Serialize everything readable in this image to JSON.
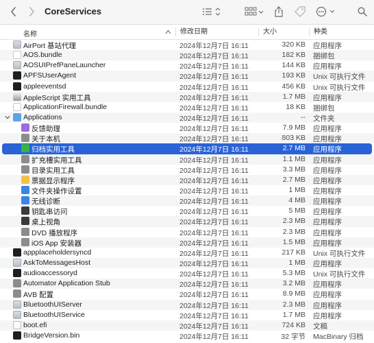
{
  "window": {
    "title": "CoreServices"
  },
  "columns": {
    "name": "名称",
    "date": "修改日期",
    "size": "大小",
    "kind": "种类"
  },
  "rows": [
    {
      "name": "AirPort 基站代理",
      "date": "2024年12月7日 16:11",
      "size": "320 KB",
      "kind": "应用程序",
      "icon": "app-icon",
      "indent": 0
    },
    {
      "name": "AOS.bundle",
      "date": "2024年12月7日 16:11",
      "size": "182 KB",
      "kind": "捆绑包",
      "icon": "bundle-icon",
      "indent": 0
    },
    {
      "name": "AOSUIPrefPaneLauncher",
      "date": "2024年12月7日 16:11",
      "size": "144 KB",
      "kind": "应用程序",
      "icon": "app-icon",
      "indent": 0
    },
    {
      "name": "APFSUserAgent",
      "date": "2024年12月7日 16:11",
      "size": "193 KB",
      "kind": "Unix 可执行文件",
      "icon": "exec-icon",
      "indent": 0
    },
    {
      "name": "appleeventsd",
      "date": "2024年12月7日 16:11",
      "size": "456 KB",
      "kind": "Unix 可执行文件",
      "icon": "exec-icon",
      "indent": 0
    },
    {
      "name": "AppleScript 实用工具",
      "date": "2024年12月7日 16:11",
      "size": "1.7 MB",
      "kind": "应用程序",
      "icon": "script-icon",
      "indent": 0
    },
    {
      "name": "ApplicationFirewall.bundle",
      "date": "2024年12月7日 16:11",
      "size": "18 KB",
      "kind": "捆绑包",
      "icon": "bundle-icon",
      "indent": 0
    },
    {
      "name": "Applications",
      "date": "2024年12月7日 16:11",
      "size": "--",
      "kind": "文件夹",
      "icon": "folder-icon",
      "indent": 0,
      "expanded": true
    },
    {
      "name": "反馈助理",
      "date": "2024年12月7日 16:11",
      "size": "7.9 MB",
      "kind": "应用程序",
      "icon": "purple-app-icon",
      "indent": 1
    },
    {
      "name": "关于本机",
      "date": "2024年12月7日 16:11",
      "size": "803 KB",
      "kind": "应用程序",
      "icon": "gray-app-icon",
      "indent": 1
    },
    {
      "name": "归档实用工具",
      "date": "2024年12月7日 16:11",
      "size": "2.7 MB",
      "kind": "应用程序",
      "icon": "green-app-icon",
      "indent": 1,
      "selected": true
    },
    {
      "name": "扩充槽实用工具",
      "date": "2024年12月7日 16:11",
      "size": "1.1 MB",
      "kind": "应用程序",
      "icon": "gray-app-icon",
      "indent": 1
    },
    {
      "name": "目录实用工具",
      "date": "2024年12月7日 16:11",
      "size": "3.3 MB",
      "kind": "应用程序",
      "icon": "gray-app-icon",
      "indent": 1
    },
    {
      "name": "票据显示程序",
      "date": "2024年12月7日 16:11",
      "size": "2.7 MB",
      "kind": "应用程序",
      "icon": "yellow-app-icon",
      "indent": 1
    },
    {
      "name": "文件夹操作设置",
      "date": "2024年12月7日 16:11",
      "size": "1 MB",
      "kind": "应用程序",
      "icon": "blue-app-icon",
      "indent": 1
    },
    {
      "name": "无线诊断",
      "date": "2024年12月7日 16:11",
      "size": "4 MB",
      "kind": "应用程序",
      "icon": "blue-app-icon",
      "indent": 1
    },
    {
      "name": "钥匙串访问",
      "date": "2024年12月7日 16:11",
      "size": "5 MB",
      "kind": "应用程序",
      "icon": "dark-app-icon",
      "indent": 1
    },
    {
      "name": "桌上视角",
      "date": "2024年12月7日 16:11",
      "size": "2.3 MB",
      "kind": "应用程序",
      "icon": "dark-app-icon",
      "indent": 1
    },
    {
      "name": "DVD 播放程序",
      "date": "2024年12月7日 16:11",
      "size": "2.3 MB",
      "kind": "应用程序",
      "icon": "gray-app-icon",
      "indent": 1
    },
    {
      "name": "iOS App 安装器",
      "date": "2024年12月7日 16:11",
      "size": "1.5 MB",
      "kind": "应用程序",
      "icon": "gray-app-icon",
      "indent": 1
    },
    {
      "name": "appplaceholdersyncd",
      "date": "2024年12月7日 16:11",
      "size": "217 KB",
      "kind": "Unix 可执行文件",
      "icon": "exec-icon",
      "indent": 0
    },
    {
      "name": "AskToMessagesHost",
      "date": "2024年12月7日 16:11",
      "size": "1 MB",
      "kind": "应用程序",
      "icon": "app-icon",
      "indent": 0
    },
    {
      "name": "audioaccessoryd",
      "date": "2024年12月7日 16:11",
      "size": "5.3 MB",
      "kind": "Unix 可执行文件",
      "icon": "exec-icon",
      "indent": 0
    },
    {
      "name": "Automator Application Stub",
      "date": "2024年12月7日 16:11",
      "size": "3.2 MB",
      "kind": "应用程序",
      "icon": "gray-app-icon",
      "indent": 0
    },
    {
      "name": "AVB 配置",
      "date": "2024年12月7日 16:11",
      "size": "8.9 MB",
      "kind": "应用程序",
      "icon": "gray-app-icon",
      "indent": 0
    },
    {
      "name": "BluetoothUIServer",
      "date": "2024年12月7日 16:11",
      "size": "2.3 MB",
      "kind": "应用程序",
      "icon": "app-icon",
      "indent": 0
    },
    {
      "name": "BluetoothUIService",
      "date": "2024年12月7日 16:11",
      "size": "1.7 MB",
      "kind": "应用程序",
      "icon": "app-icon",
      "indent": 0
    },
    {
      "name": "boot.efi",
      "date": "2024年12月7日 16:11",
      "size": "724 KB",
      "kind": "文稿",
      "icon": "doc-icon",
      "indent": 0
    },
    {
      "name": "BridgeVersion.bin",
      "date": "2024年12月7日 16:11",
      "size": "32 字节",
      "kind": "MacBinary 归档",
      "icon": "exec-icon",
      "indent": 0
    }
  ]
}
